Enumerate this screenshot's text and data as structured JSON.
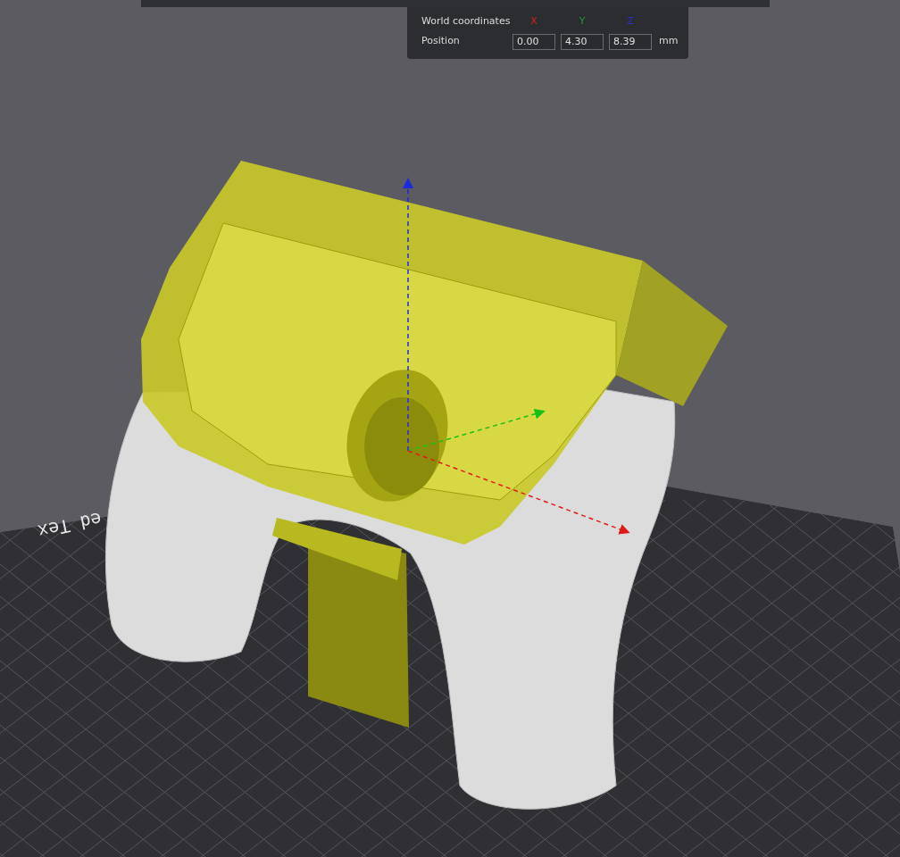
{
  "coords_panel": {
    "title": "World coordinates",
    "row_label": "Position",
    "unit": "mm",
    "axes": [
      {
        "label": "X",
        "color": "#d42020",
        "value": "0.00"
      },
      {
        "label": "Y",
        "color": "#1f9a3a",
        "value": "4.30"
      },
      {
        "label": "Z",
        "color": "#2b2bd0",
        "value": "8.39"
      }
    ]
  },
  "bed_label": "ed Tex"
}
